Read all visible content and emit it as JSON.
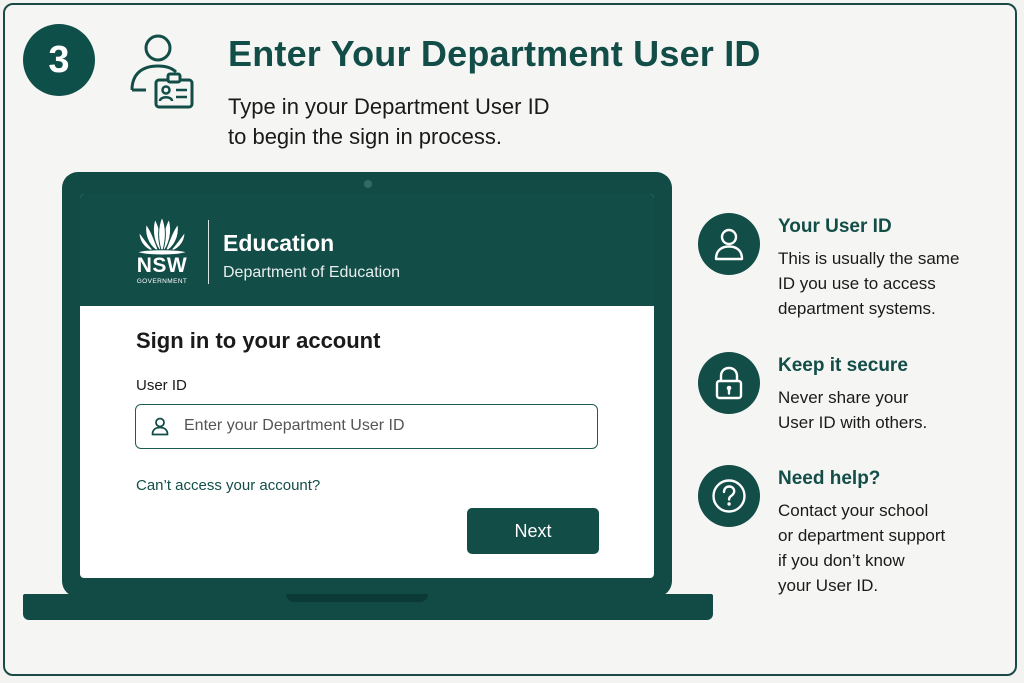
{
  "step": {
    "number": "3"
  },
  "header": {
    "title": "Enter Your Department User ID",
    "subtitle_lines": [
      "Type in your Department User ID",
      "to begin the sign in process."
    ]
  },
  "app": {
    "brand": {
      "nsw": "NSW",
      "government": "GOVERNMENT"
    },
    "name": "Education",
    "subtitle": "Department of Education",
    "form": {
      "title": "Sign in to your account",
      "label": "User ID",
      "placeholder": "Enter your Department User ID",
      "value": "",
      "cant_access": "Can’t access your account?",
      "next_label": "Next"
    }
  },
  "tips": [
    {
      "icon": "user-icon",
      "title": "Your User ID",
      "lines": [
        "This is usually the same",
        "ID you use to access",
        "department systems."
      ]
    },
    {
      "icon": "lock-icon",
      "title": "Keep it secure",
      "lines": [
        "Never share your",
        "User ID with others."
      ]
    },
    {
      "icon": "question-icon",
      "title": "Need help?",
      "lines": [
        "Contact your school",
        "or department support",
        "if you don’t know",
        "your User ID."
      ]
    }
  ],
  "colors": {
    "primary": "#124d48",
    "background": "#f5f5f3",
    "text": "#1a1a1a"
  }
}
